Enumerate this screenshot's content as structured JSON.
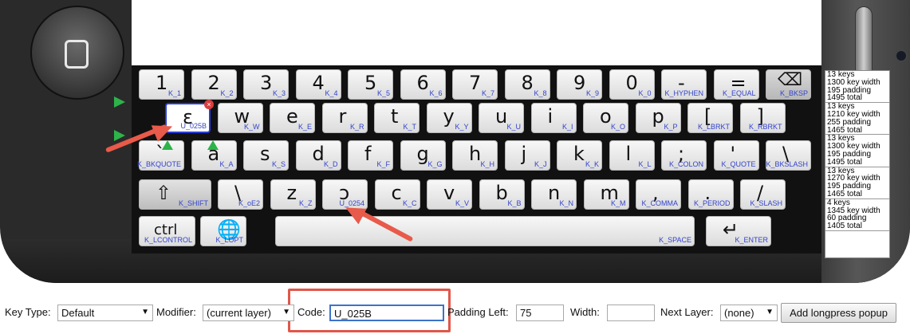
{
  "keyboard": {
    "rows": [
      [
        {
          "main": "1",
          "code": "K_1"
        },
        {
          "main": "2",
          "code": "K_2"
        },
        {
          "main": "3",
          "code": "K_3"
        },
        {
          "main": "4",
          "code": "K_4"
        },
        {
          "main": "5",
          "code": "K_5"
        },
        {
          "main": "6",
          "code": "K_6"
        },
        {
          "main": "7",
          "code": "K_7"
        },
        {
          "main": "8",
          "code": "K_8"
        },
        {
          "main": "9",
          "code": "K_9"
        },
        {
          "main": "0",
          "code": "K_0"
        },
        {
          "main": "-",
          "code": "K_HYPHEN"
        },
        {
          "main": "=",
          "code": "K_EQUAL"
        },
        {
          "main": "⌫",
          "code": "K_BKSP"
        }
      ],
      [
        {
          "main": "ɛ",
          "code": "U_025B"
        },
        {
          "main": "w",
          "code": "K_W"
        },
        {
          "main": "e",
          "code": "K_E"
        },
        {
          "main": "r",
          "code": "K_R"
        },
        {
          "main": "t",
          "code": "K_T"
        },
        {
          "main": "y",
          "code": "K_Y"
        },
        {
          "main": "u",
          "code": "K_U"
        },
        {
          "main": "i",
          "code": "K_I"
        },
        {
          "main": "o",
          "code": "K_O"
        },
        {
          "main": "p",
          "code": "K_P"
        },
        {
          "main": "[",
          "code": "K_LBRKT"
        },
        {
          "main": "]",
          "code": "K_RBRKT"
        }
      ],
      [
        {
          "main": "`",
          "code": "K_BKQUOTE"
        },
        {
          "main": "a",
          "code": "K_A"
        },
        {
          "main": "s",
          "code": "K_S"
        },
        {
          "main": "d",
          "code": "K_D"
        },
        {
          "main": "f",
          "code": "K_F"
        },
        {
          "main": "g",
          "code": "K_G"
        },
        {
          "main": "h",
          "code": "K_H"
        },
        {
          "main": "j",
          "code": "K_J"
        },
        {
          "main": "k",
          "code": "K_K"
        },
        {
          "main": "l",
          "code": "K_L"
        },
        {
          "main": ";",
          "code": "K_COLON"
        },
        {
          "main": "'",
          "code": "K_QUOTE"
        },
        {
          "main": "\\",
          "code": "K_BKSLASH"
        }
      ],
      [
        {
          "main": "⇧",
          "code": "K_SHIFT"
        },
        {
          "main": "\\",
          "code": "K_oE2"
        },
        {
          "main": "z",
          "code": "K_Z"
        },
        {
          "main": "ɔ",
          "code": "U_0254"
        },
        {
          "main": "c",
          "code": "K_C"
        },
        {
          "main": "v",
          "code": "K_V"
        },
        {
          "main": "b",
          "code": "K_B"
        },
        {
          "main": "n",
          "code": "K_N"
        },
        {
          "main": "m",
          "code": "K_M"
        },
        {
          "main": ",",
          "code": "K_COMMA"
        },
        {
          "main": ".",
          "code": "K_PERIOD"
        },
        {
          "main": "/",
          "code": "K_SLASH"
        }
      ],
      [
        {
          "main": "ctrl",
          "code": "K_LCONTROL"
        },
        {
          "main": "🌐",
          "code": "K_LOPT"
        },
        {
          "main": "",
          "code": "K_SPACE"
        },
        {
          "main": "↵",
          "code": "K_ENTER"
        }
      ]
    ],
    "row_info": [
      [
        "13 keys",
        "1300 key width",
        "195 padding",
        "1495 total"
      ],
      [
        "13 keys",
        "1210 key width",
        "255 padding",
        "1465 total"
      ],
      [
        "13 keys",
        "1300 key width",
        "195 padding",
        "1495 total"
      ],
      [
        "13 keys",
        "1270 key width",
        "195 padding",
        "1465 total"
      ],
      [
        "4 keys",
        "1345 key width",
        "60 padding",
        "1405 total"
      ]
    ]
  },
  "toolbar": {
    "key_type_label": "Key Type:",
    "key_type_value": "Default",
    "modifier_label": "Modifier:",
    "modifier_value": "(current layer)",
    "code_label": "Code:",
    "code_value": "U_025B",
    "padding_left_label": "Padding Left:",
    "padding_left_value": "75",
    "width_label": "Width:",
    "width_value": "",
    "next_layer_label": "Next Layer:",
    "next_layer_value": "(none)",
    "add_longpress_label": "Add longpress popup"
  },
  "colors": {
    "accent_red": "#e0574a",
    "key_code_blue": "#3344cc",
    "selected_border": "#2a3ed6",
    "green_marker": "#2db34a"
  }
}
